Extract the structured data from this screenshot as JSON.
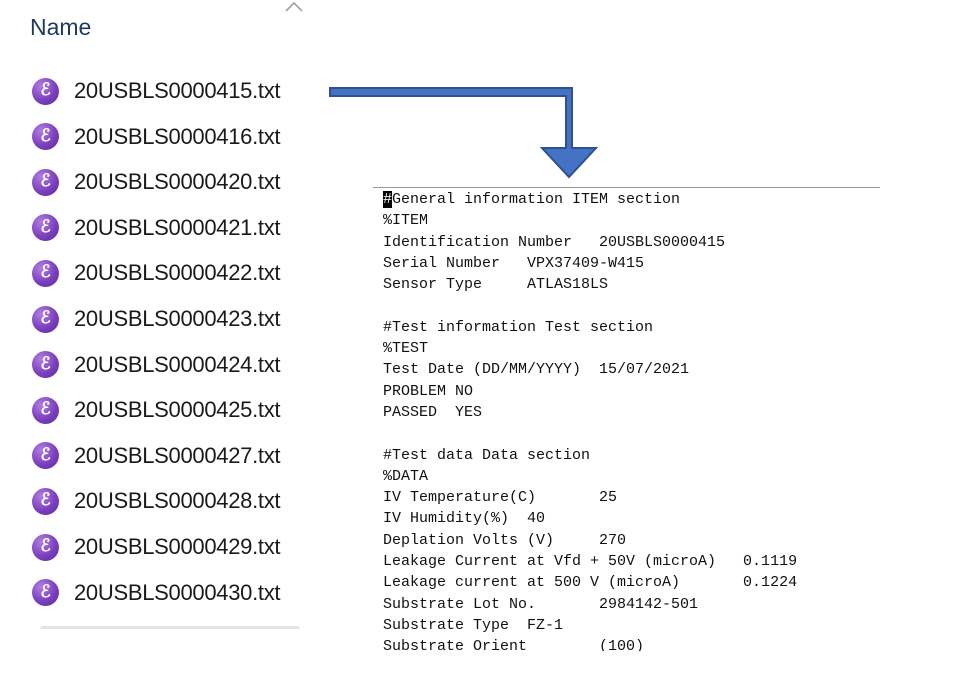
{
  "explorer": {
    "column_header": "Name",
    "files": [
      "20USBLS0000415.txt",
      "20USBLS0000416.txt",
      "20USBLS0000420.txt",
      "20USBLS0000421.txt",
      "20USBLS0000422.txt",
      "20USBLS0000423.txt",
      "20USBLS0000424.txt",
      "20USBLS0000425.txt",
      "20USBLS0000427.txt",
      "20USBLS0000428.txt",
      "20USBLS0000429.txt",
      "20USBLS0000430.txt"
    ],
    "file_icon": "emacs-icon",
    "icon_glyph": "ℰ",
    "sort_icon": "chevron-up-icon"
  },
  "document": {
    "cursor_char": "#",
    "lines": [
      "General information ITEM section",
      "%ITEM",
      "Identification Number   20USBLS0000415",
      "Serial Number   VPX37409-W415",
      "Sensor Type     ATLAS18LS",
      "",
      "#Test information Test section",
      "%TEST",
      "Test Date (DD/MM/YYYY)  15/07/2021",
      "PROBLEM NO",
      "PASSED  YES",
      "",
      "#Test data Data section",
      "%DATA",
      "IV Temperature(C)       25",
      "IV Humidity(%)  40",
      "Deplation Volts (V)     270",
      "Leakage Current at Vfd + 50V (microA)   0.1119",
      "Leakage current at 500 V (microA)       0.1224",
      "Substrate Lot No.       2984142-501",
      "Substrate Type  FZ-1",
      "Substrate Orient        (100)"
    ]
  },
  "colors": {
    "arrow_fill": "#4472c4",
    "arrow_stroke": "#2f528f",
    "header_text": "#1e3a5f",
    "icon_purple": "#7c3fbf"
  }
}
